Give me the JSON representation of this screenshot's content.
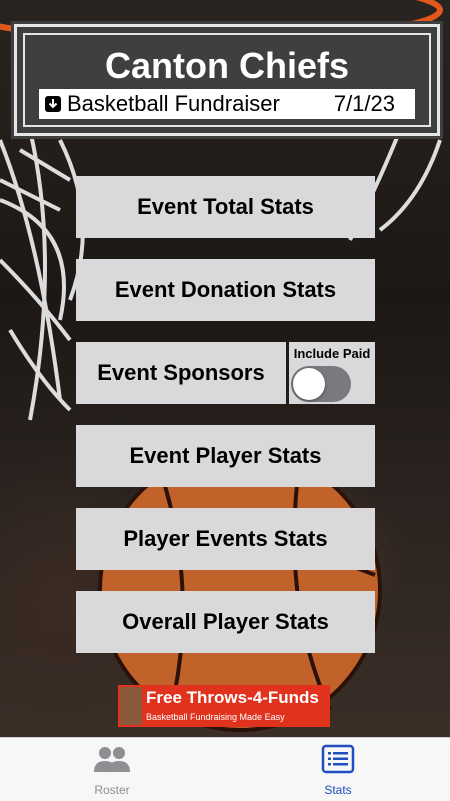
{
  "header": {
    "title": "Canton Chiefs",
    "event_name": "Basketball Fundraiser",
    "event_date": "7/1/23"
  },
  "menu": [
    {
      "label": "Event Total Stats"
    },
    {
      "label": "Event Donation Stats"
    },
    {
      "label": "Event Sponsors"
    },
    {
      "label": "Event Player Stats"
    },
    {
      "label": "Player Events Stats"
    },
    {
      "label": "Overall Player Stats"
    }
  ],
  "sponsors_toggle": {
    "label": "Include Paid",
    "on": false
  },
  "ad": {
    "title": "Free Throws-4-Funds",
    "subtitle": "Basketball Fundraising Made Easy"
  },
  "tabbar": {
    "tabs": [
      {
        "label": "Roster",
        "icon": "people-icon",
        "active": false
      },
      {
        "label": "Stats",
        "icon": "list-icon",
        "active": true
      }
    ],
    "active_color": "#1f4fbf",
    "inactive_color": "#8e8e93"
  }
}
